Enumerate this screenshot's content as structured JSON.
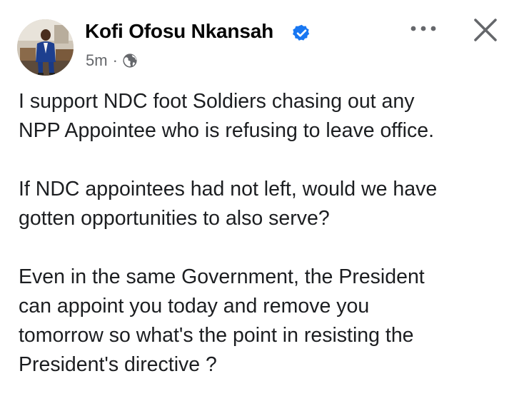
{
  "post": {
    "author": "Kofi Ofosu Nkansah",
    "time": "5m",
    "separator": "·",
    "verified_icon": "verified-badge-icon",
    "privacy_icon": "globe-icon",
    "menu_icon": "more-horizontal-icon",
    "close_icon": "close-icon",
    "accent_color": "#1877f2",
    "paragraphs": [
      [
        "I support NDC foot Soldiers chasing out any",
        "NPP Appointee who is refusing to leave office."
      ],
      [
        "If NDC appointees had not left, would we have",
        "gotten opportunities to also serve?"
      ],
      [
        "Even in the same Government, the President",
        "can appoint you today and remove you",
        "tomorrow so what's the point in resisting the",
        "President's directive ?"
      ]
    ]
  }
}
